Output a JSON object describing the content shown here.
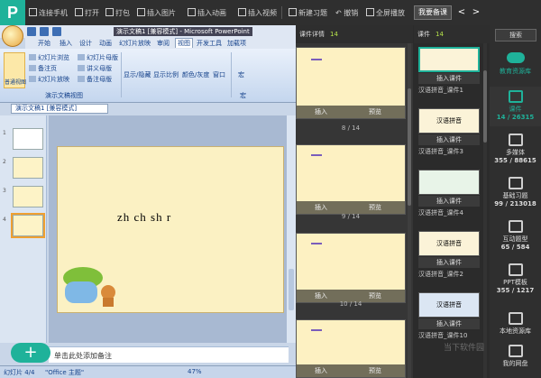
{
  "topbar": {
    "logo": "P",
    "items": [
      "连接手机",
      "打开",
      "打包",
      "插入图片",
      "插入动画",
      "插入视频",
      "新建习题",
      "撤销",
      "全屏播放"
    ],
    "prepare_btn": "我要备课",
    "prev": "<",
    "next": ">"
  },
  "ppt": {
    "window_title": "演示文稿1 [兼容模式] - Microsoft PowerPoint",
    "tabs": [
      "开始",
      "插入",
      "设计",
      "动画",
      "幻灯片放映",
      "审阅",
      "视图",
      "开发工具",
      "加载项"
    ],
    "active_tab": "视图",
    "ribbon": {
      "normal_view": "普通视图",
      "slide_browse": "幻灯片浏览",
      "notes_page": "备注页",
      "slide_show": "幻灯片放映",
      "slide_master": "幻灯片母版",
      "handout_master": "讲义母版",
      "notes_master": "备注母版",
      "group_label": "演示文稿视图",
      "show_hide": "显示/隐藏",
      "zoom": "显示比例",
      "color_gray": "颜色/灰度",
      "window": "窗口",
      "macro": "宏",
      "macro_group": "宏"
    },
    "doc_tab": "演示文稿1 [兼容模式]",
    "slide_text": "zh ch sh r",
    "notes_placeholder": "单击此处添加备注",
    "status": {
      "slide": "幻灯片 4/4",
      "theme": "\"Office 主题\"",
      "zoom": "47%"
    },
    "thumb_numbers": [
      "1",
      "2",
      "3",
      "4"
    ]
  },
  "detail": {
    "title": "课件详情",
    "count": "14",
    "cards": [
      {
        "insert": "插入",
        "preview": "预览",
        "page": "8 / 14"
      },
      {
        "insert": "插入",
        "preview": "预览",
        "page": "9 / 14"
      },
      {
        "insert": "插入",
        "preview": "预览",
        "page": "10 / 14"
      },
      {
        "insert": "插入",
        "preview": "预览",
        "page": ""
      }
    ]
  },
  "list": {
    "title": "课件",
    "count": "14",
    "items": [
      {
        "thumb": "",
        "btn": "插入课件",
        "name": "汉语拼音_课件1"
      },
      {
        "thumb": "汉语拼音",
        "btn": "插入课件",
        "name": "汉语拼音_课件3"
      },
      {
        "thumb": "",
        "btn": "插入课件",
        "name": "汉语拼音_课件4"
      },
      {
        "thumb": "汉语拼音",
        "btn": "插入课件",
        "name": "汉语拼音_课件2"
      },
      {
        "thumb": "汉语拼音",
        "btn": "插入课件",
        "name": "汉语拼音_课件10"
      }
    ]
  },
  "side": {
    "search": "搜索",
    "resource_lib": "教育资源库",
    "items": [
      {
        "label": "课件",
        "num": "14 / 26315"
      },
      {
        "label": "多媒体",
        "num": "355 / 88615"
      },
      {
        "label": "基础习题",
        "num": "99 / 213018"
      },
      {
        "label": "互动题型",
        "num": "65 / 584"
      },
      {
        "label": "PPT模板",
        "num": "355 / 1217"
      },
      {
        "label": "本地资源库",
        "num": ""
      },
      {
        "label": "我的网盘",
        "num": ""
      }
    ]
  },
  "watermark": "当下软件园",
  "colors": {
    "accent": "#1fb29a",
    "count": "#b5e14a"
  }
}
